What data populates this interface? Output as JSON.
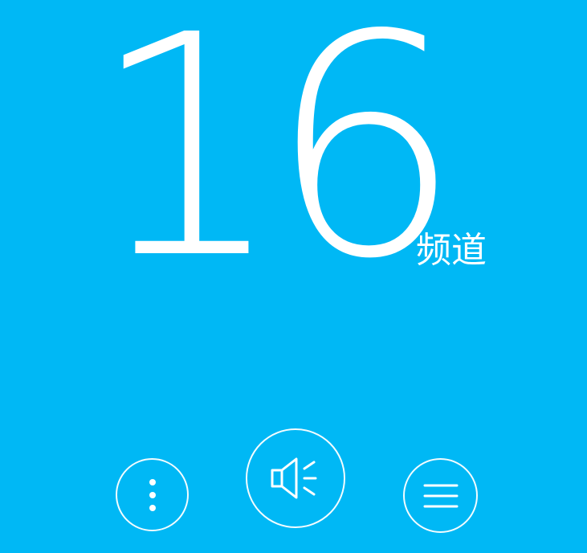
{
  "channel": {
    "number": "16",
    "unit": "频道"
  },
  "controls": {
    "more_icon": "more-vertical-icon",
    "volume_icon": "speaker-icon",
    "menu_icon": "menu-lines-icon"
  },
  "colors": {
    "background": "#00b8f5",
    "foreground": "#ffffff"
  }
}
